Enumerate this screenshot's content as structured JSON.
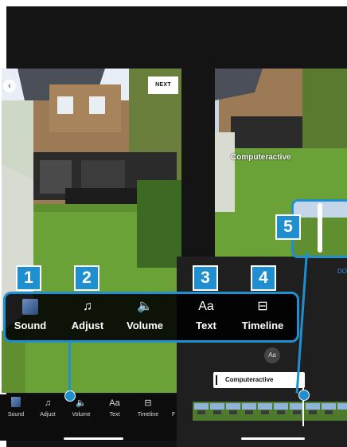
{
  "left_screen": {
    "next_label": "NEXT",
    "back_icon": "chevron-left-icon",
    "tools": [
      {
        "icon": "sound-thumbnail-icon",
        "label": "Sound"
      },
      {
        "icon": "music-scissors-icon",
        "label": "Adjust"
      },
      {
        "icon": "speaker-icon",
        "label": "Volume"
      },
      {
        "icon": "text-aa-icon",
        "label": "Text",
        "glyph": "Aa"
      },
      {
        "icon": "timeline-icon",
        "label": "Timeline"
      }
    ],
    "partial_tool_glyph": "F"
  },
  "right_screen": {
    "caption": "Computeractive",
    "done_label": "DO",
    "text_clip_label": "Computeractive",
    "aa_button": "Aa"
  },
  "callouts": {
    "numbers": [
      "1",
      "2",
      "3",
      "4",
      "5"
    ],
    "color": "#1f8fd0"
  },
  "toolbox": {
    "tools": [
      {
        "icon": "sound-thumbnail-icon",
        "label": "Sound"
      },
      {
        "icon": "music-scissors-icon",
        "label": "Adjust"
      },
      {
        "icon": "speaker-icon",
        "label": "Volume"
      },
      {
        "icon": "text-aa-icon",
        "label": "Text",
        "glyph": "Aa"
      },
      {
        "icon": "timeline-icon",
        "label": "Timeline"
      }
    ]
  }
}
